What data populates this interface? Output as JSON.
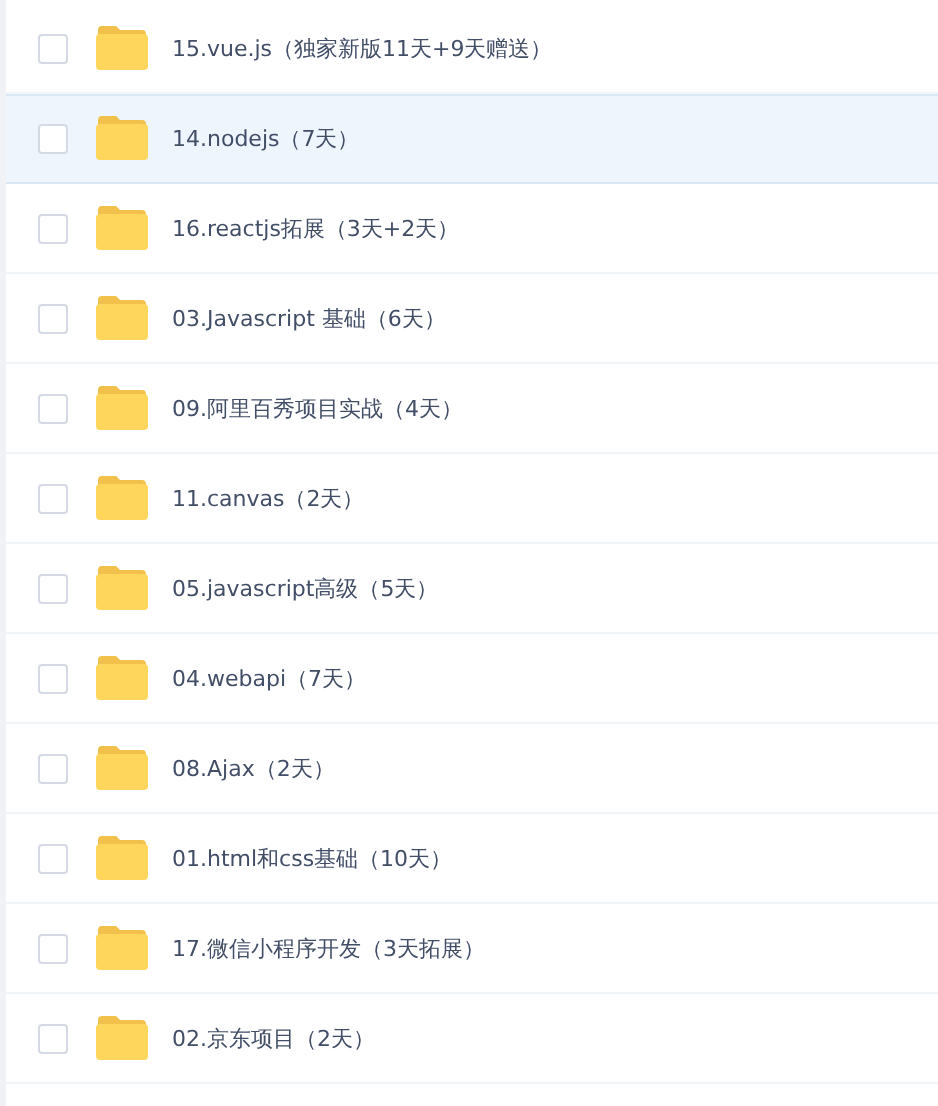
{
  "files": [
    {
      "name": "15.vue.js（独家新版11天+9天赠送）",
      "checked": false,
      "hovered": false
    },
    {
      "name": "14.nodejs（7天）",
      "checked": false,
      "hovered": true
    },
    {
      "name": "16.reactjs拓展（3天+2天）",
      "checked": false,
      "hovered": false
    },
    {
      "name": "03.Javascript 基础（6天）",
      "checked": false,
      "hovered": false
    },
    {
      "name": "09.阿里百秀项目实战（4天）",
      "checked": false,
      "hovered": false
    },
    {
      "name": "11.canvas（2天）",
      "checked": false,
      "hovered": false
    },
    {
      "name": "05.javascript高级（5天）",
      "checked": false,
      "hovered": false
    },
    {
      "name": "04.webapi（7天）",
      "checked": false,
      "hovered": false
    },
    {
      "name": "08.Ajax（2天）",
      "checked": false,
      "hovered": false
    },
    {
      "name": "01.html和css基础（10天）",
      "checked": false,
      "hovered": false
    },
    {
      "name": "17.微信小程序开发（3天拓展）",
      "checked": false,
      "hovered": false
    },
    {
      "name": "02.京东项目（2天）",
      "checked": false,
      "hovered": false
    }
  ]
}
